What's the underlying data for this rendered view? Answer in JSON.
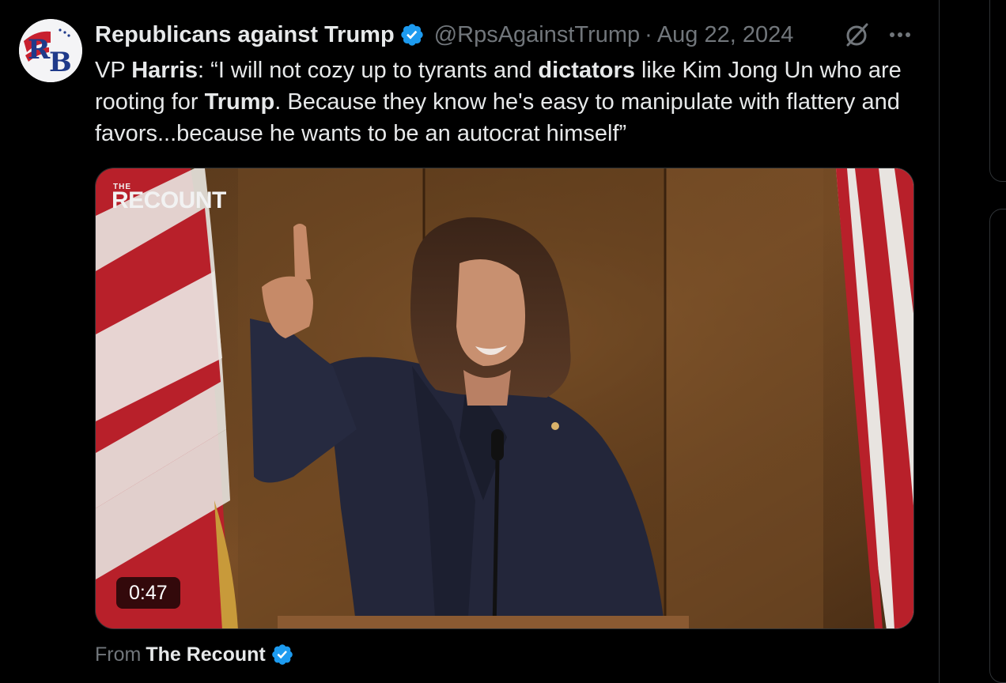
{
  "author": {
    "display_name": "Republicans against Trump",
    "handle": "@RpsAgainstTrump",
    "separator": "·",
    "date": "Aug 22, 2024",
    "avatar_text": "RB"
  },
  "icons": {
    "verified": "verified-badge-icon",
    "grok": "grok-icon",
    "more": "more-options-icon"
  },
  "colors": {
    "verified_blue": "#1d9bf0",
    "secondary_text": "#71767b",
    "primary_text": "#e7e9ea"
  },
  "text": {
    "p1": "VP ",
    "b1": "Harris",
    "p2": ": “I will not cozy up to tyrants and ",
    "b2": "dictators",
    "p3": " like Kim Jong Un who are rooting for ",
    "b3": "Trump",
    "p4": ". Because they know he's easy to manipulate with flattery and favors...because he wants to be an autocrat himself”"
  },
  "media": {
    "watermark_small": "THE",
    "watermark_main": "RECOUNT",
    "duration": "0:47"
  },
  "source": {
    "label": "From",
    "name": "The Recount"
  }
}
